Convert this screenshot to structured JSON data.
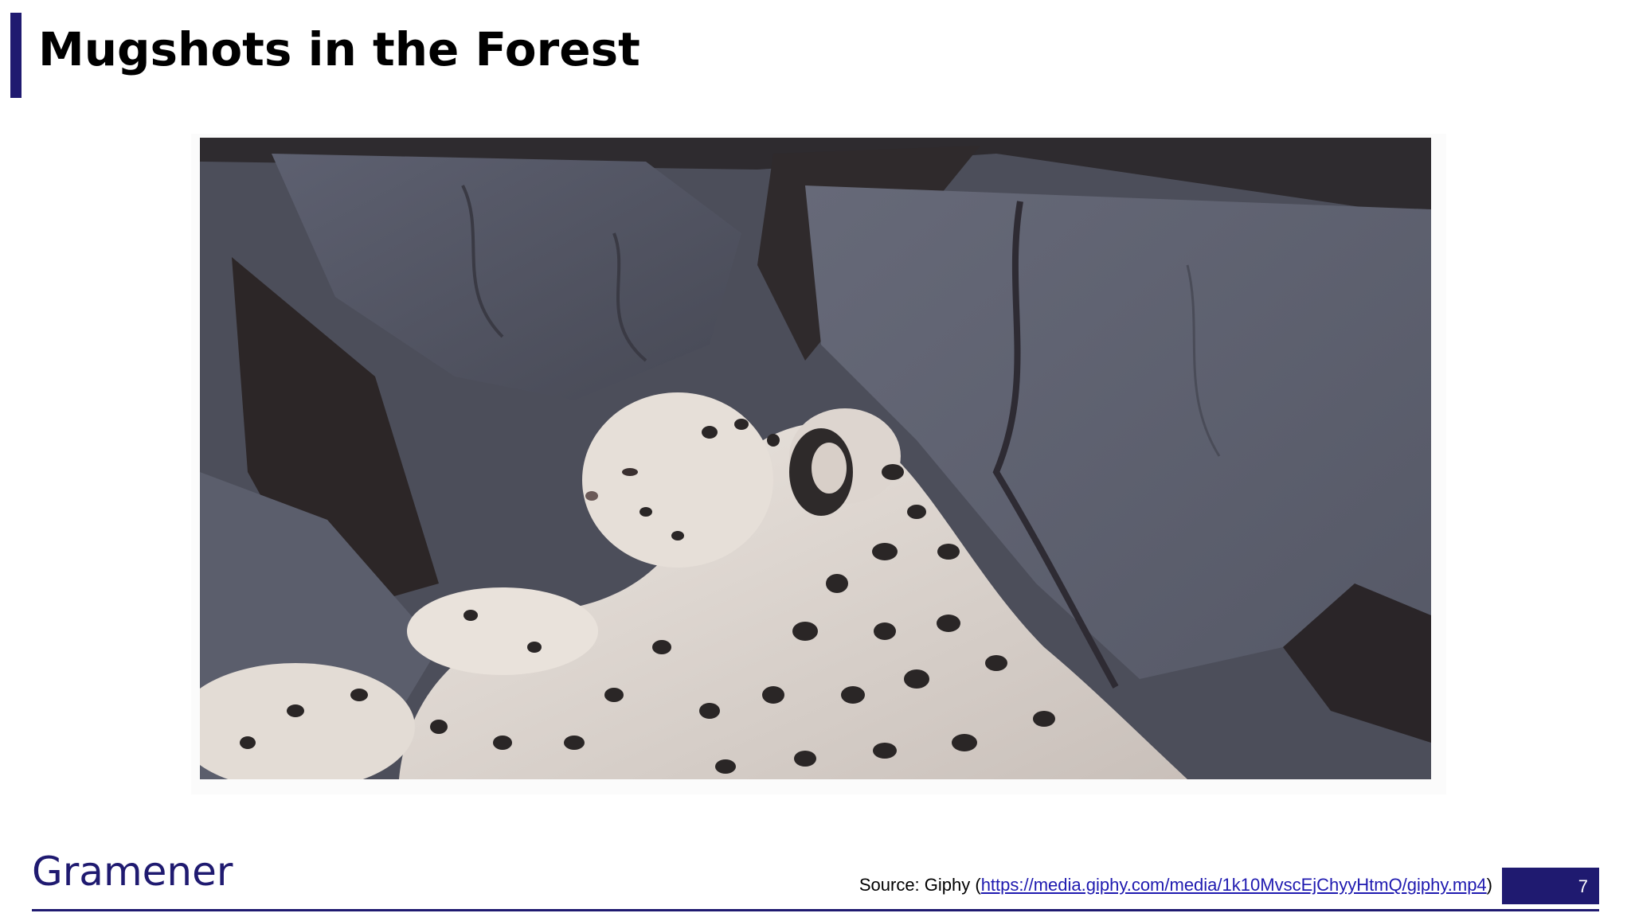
{
  "slide": {
    "title": "Mugshots in the Forest",
    "image_subject": "snow-leopard-photo"
  },
  "footer": {
    "logo_text": "Gramener",
    "source_prefix": "Source: Giphy (",
    "source_link": "https://media.giphy.com/media/1k10MvscEjChyyHtmQ/giphy.mp4",
    "source_suffix": ")",
    "page_number": "7"
  },
  "colors": {
    "accent": "#1f1a70",
    "link": "#1f1ab0"
  }
}
